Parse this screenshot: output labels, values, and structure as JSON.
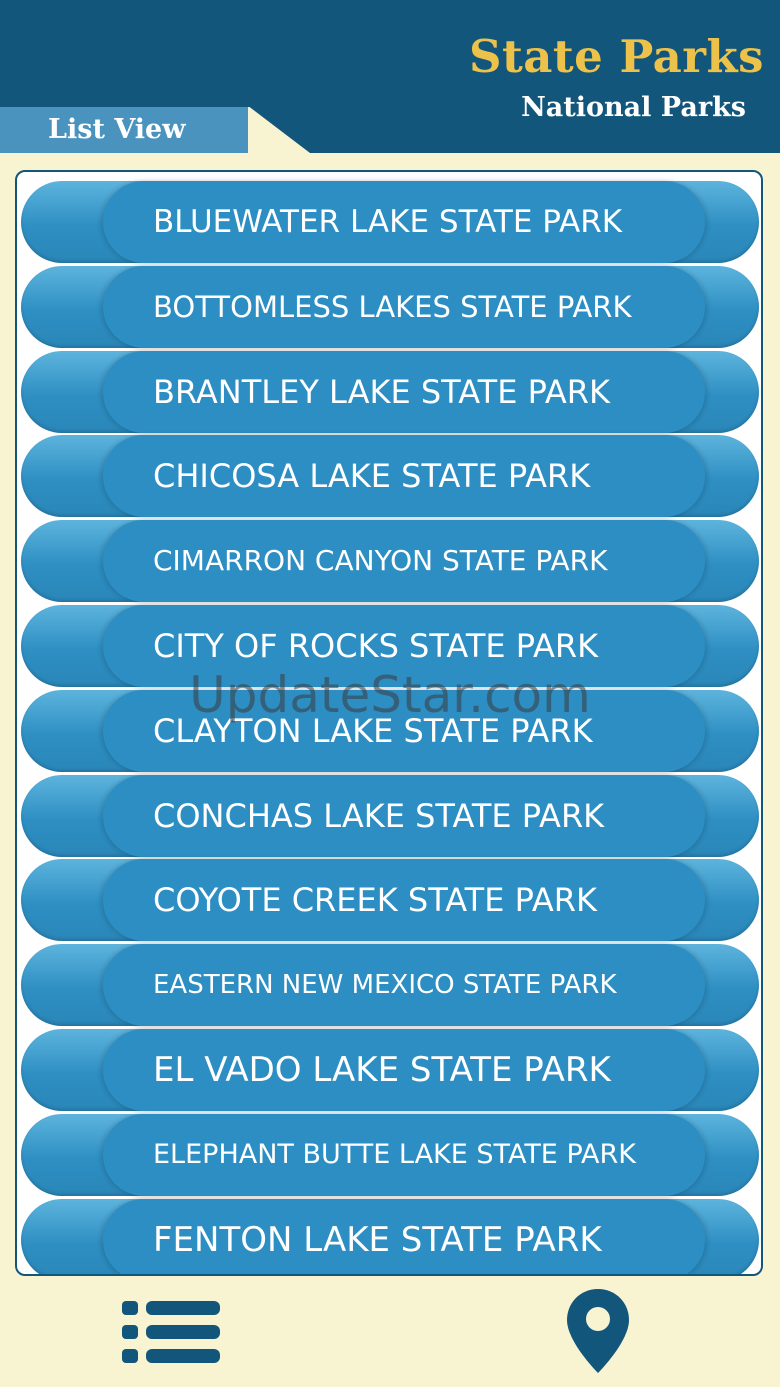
{
  "header": {
    "title": "State Parks",
    "subtitle": "National Parks",
    "tab_label": "List View"
  },
  "parks": [
    "BLUEWATER LAKE STATE PARK",
    "BOTTOMLESS LAKES STATE PARK",
    "BRANTLEY LAKE STATE PARK",
    "CHICOSA LAKE STATE PARK",
    "CIMARRON CANYON STATE PARK",
    "CITY OF ROCKS STATE PARK",
    "CLAYTON LAKE STATE PARK",
    "CONCHAS LAKE STATE PARK",
    "COYOTE CREEK STATE PARK",
    "EASTERN NEW MEXICO STATE PARK",
    "EL VADO LAKE STATE PARK",
    "ELEPHANT BUTTE LAKE STATE PARK",
    "FENTON LAKE STATE PARK"
  ],
  "watermark": "UpdateStar.com",
  "bottom_nav": {
    "list_icon": "list-icon",
    "map_icon": "map-pin-icon"
  },
  "colors": {
    "header_bg": "#13567b",
    "title": "#ecc24a",
    "page_bg": "#f8f3d1",
    "tab_bg": "#4a93be",
    "item_blue": "#2c8ec3"
  }
}
